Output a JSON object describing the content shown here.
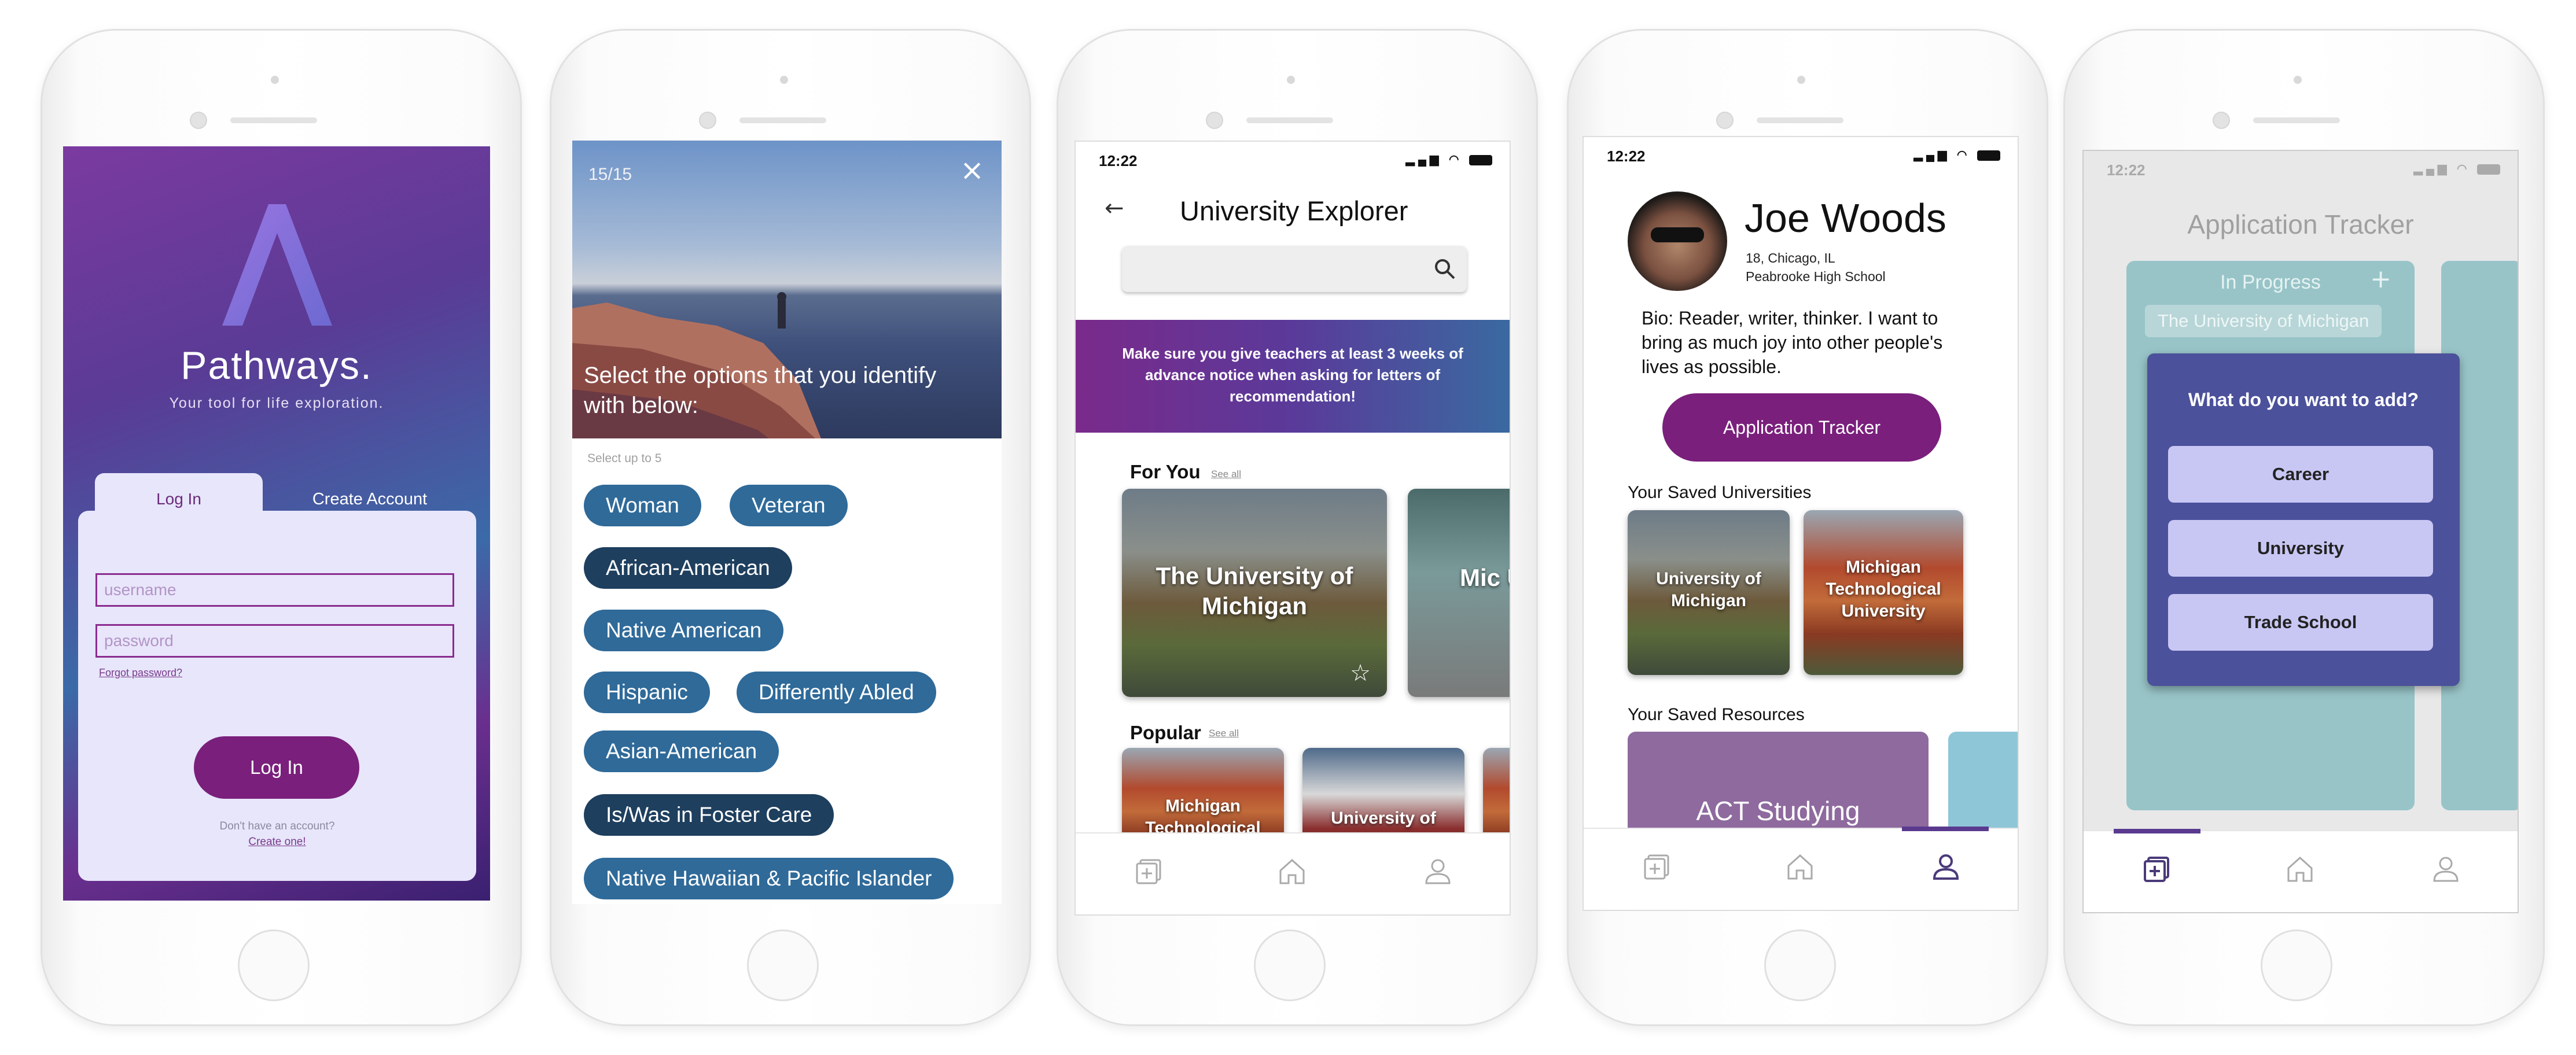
{
  "status": {
    "time": "12:22"
  },
  "screen1": {
    "logo_glyph": "Λ",
    "title": "Pathways.",
    "tagline": "Your tool for life exploration.",
    "tab_login": "Log In",
    "tab_create": "Create Account",
    "username_placeholder": "username",
    "password_placeholder": "password",
    "forgot": "Forgot password?",
    "login_button": "Log In",
    "no_account": "Don't have an account?",
    "create_one": "Create one!"
  },
  "screen2": {
    "progress": "15/15",
    "close_glyph": "×",
    "prompt": "Select the options that you identify with below:",
    "hint": "Select up to 5",
    "chips": [
      "Woman",
      "Veteran",
      "African-American",
      "Native American",
      "Hispanic",
      "Differently Abled",
      "Asian-American",
      "Is/Was in Foster Care",
      "Native Hawaiian & Pacific Islander"
    ]
  },
  "screen3": {
    "title": "University Explorer",
    "back_glyph": "←",
    "banner": "Make sure you give teachers at least 3 weeks of advance notice when asking for letters of recommendation!",
    "for_you": "For You",
    "popular": "Popular",
    "see_all": "See all",
    "card_umich": "The University of Michigan",
    "card_partial": "Mic U",
    "card_mtu": "Michigan Technological",
    "card_uw": "University of"
  },
  "screen4": {
    "name": "Joe Woods",
    "meta_line1": "18, Chicago, IL",
    "meta_line2": "Peabrooke High School",
    "bio": "Bio: Reader, writer, thinker. I want to bring as much joy into other people's lives as possible.",
    "tracker_button": "Application Tracker",
    "saved_unis": "Your Saved Universities",
    "uni1": "University of Michigan",
    "uni2": "Michigan Technological University",
    "saved_resources": "Your Saved Resources",
    "resource1": "ACT Studying"
  },
  "screen5": {
    "title": "Application Tracker",
    "column": "In Progress",
    "plus_glyph": "+",
    "item": "The University of Michigan",
    "modal_title": "What do you want to add?",
    "options": [
      "Career",
      "University",
      "Trade School"
    ]
  },
  "colors": {
    "brand_purple": "#7a1f7c",
    "chip_blue": "#2f6a99",
    "chip_navy": "#1e3f5e",
    "modal": "#4c519b"
  }
}
